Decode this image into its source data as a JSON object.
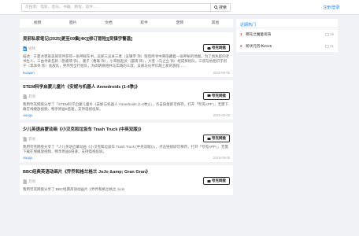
{
  "header": {
    "search_placeholder": "可搜索：电影、音乐、书籍、教程、软件…",
    "search_button": "搜索",
    "login_label": "注册/登录"
  },
  "tabs": [
    "视频",
    "图片",
    "文档",
    "软件",
    "音频",
    "其他"
  ],
  "items": [
    {
      "title": "吴邪私家笔记(2025)更至09集[4K][修订冒险][吴镇宇警嘉]",
      "type": "视频",
      "action": "夸克网盘",
      "desc": "描述：于夏冰善族美邪资件获得一张神秘车书，吴邪三吴关三者（吴镇宇 饰）取现所寻中黄隐藏着一张神秘的地图。为了找失踪的老书生人，三由寻索瓦新（曾嘉瑛 饰），潘子（曹瑜 饰），小哥张起灵（晨雨 饰），大奎（马之立 饰）组成探险队，三叔与他相识于阿宁（李沐英 饰）会族队，突然完全行组队，为阅明真相并与实践的三叔，吴邪与伙伴们踏上新的旅程……",
      "source": "kuaipan",
      "date": "2026-09-06"
    },
    {
      "title": "STEM科学启蒙儿童片《安妮与机器人 Annedroids (1-4季)》",
      "type": "其他",
      "action": "夸克网盘",
      "desc": "我用夸克网盘分享了「STEM科学启蒙儿童片《安妮与机器人 Annedroids (1-4季)》」，点击链接即可保存。打开「夸克APP」，无需下载在线播放视频，畅享原画5倍速，支持电视投屏。",
      "source": "xiaogu",
      "date": "2026-09-06"
    },
    {
      "title": "少儿英语启蒙动画《小汉克和垃圾车 Trash Truck (中英双版)》",
      "type": "其他",
      "action": "夸克网盘",
      "desc": "我用夸克网盘分享了「少儿英语启蒙动画《小汉克和垃圾车 Trash Truck (中英双版)》」，点击链接即可保存。打开「夸克APP」，无需下载在线播放视频，畅享原画5倍速，支持电视投屏。",
      "source": "xiaogu",
      "date": "2026-09-06"
    },
    {
      "title": "BBC经典英语动画片《乔乔和格兰格兰 JoJo &amp; Gran Gran》",
      "type": "其他",
      "action": "夸克网盘",
      "desc": "我用夸克网盘分享了:BBC经典英语动画片《乔乔和格兰格兰 JoJo",
      "source": "",
      "date": ""
    }
  ],
  "sidebar": {
    "title": "近期热门",
    "items": [
      {
        "rank": "1",
        "label": "哪吒之魔童闹海",
        "count": "66"
      },
      {
        "rank": "2",
        "label": "新状元历书2025",
        "count": "51"
      }
    ]
  },
  "colors": {
    "accent": "#1e88e5",
    "rank": "#c0392b",
    "background": "#f1f2f5"
  }
}
